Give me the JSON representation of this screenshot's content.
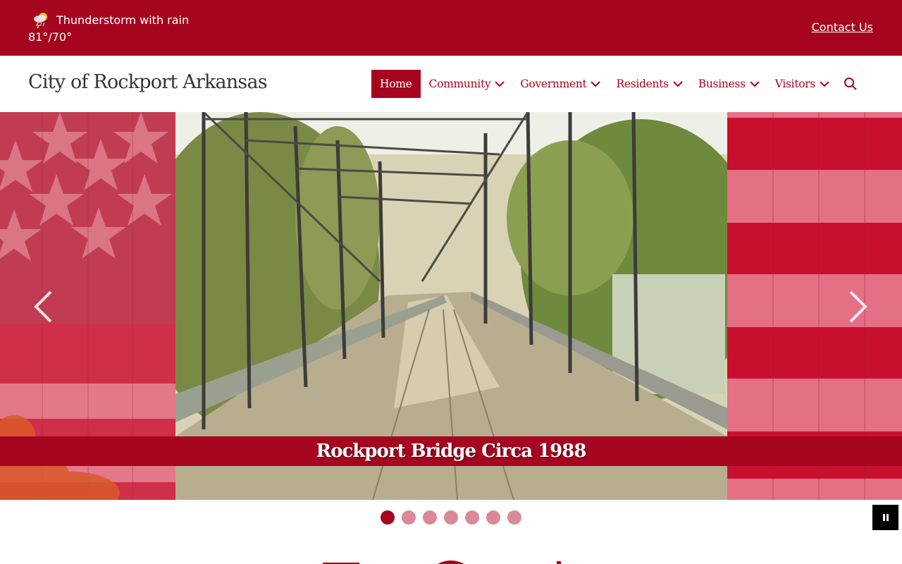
{
  "topbar": {
    "weather_icon": "thunderstorm-rain-icon",
    "weather_condition": "Thunderstorm with rain",
    "weather_temps": "81°/70°",
    "contact_label": "Contact Us"
  },
  "header": {
    "site_title": "City of Rockport Arkansas"
  },
  "nav": {
    "items": [
      {
        "label": "Home",
        "active": true
      },
      {
        "label": "Community",
        "dropdown": true
      },
      {
        "label": "Government",
        "dropdown": true
      },
      {
        "label": "Residents",
        "dropdown": true
      },
      {
        "label": "Business",
        "dropdown": true
      },
      {
        "label": "Visitors",
        "dropdown": true
      }
    ],
    "search_icon": "search-icon"
  },
  "slideshow": {
    "caption": "Rockport Bridge Circa 1988",
    "slide_count": 7,
    "active_slide": 1,
    "prev_icon": "chevron-left-icon",
    "next_icon": "chevron-right-icon",
    "pause_icon": "pause-icon"
  },
  "colors": {
    "brand": "#a6051f",
    "dot_inactive": "#d98a96"
  }
}
